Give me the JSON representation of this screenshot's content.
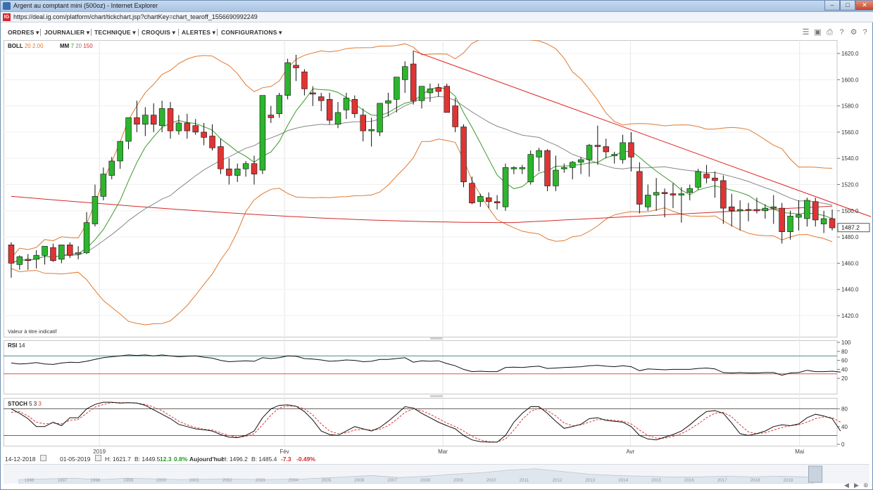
{
  "window": {
    "title": "Argent au comptant mini (500oz) - Internet Explorer",
    "url": "https://deal.ig.com/platform/chart/tickchart.jsp?chartKey=chart_tearoff_1556690992249",
    "logo": "IG"
  },
  "menu": [
    {
      "label": "ORDRES"
    },
    {
      "label": "JOURNALIER"
    },
    {
      "label": "TECHNIQUE"
    },
    {
      "label": "CROQUIS"
    },
    {
      "label": "ALERTES"
    },
    {
      "label": "CONFIGURATIONS"
    }
  ],
  "toolbar_icons": [
    "layers-icon",
    "image-icon",
    "print-icon",
    "help-icon",
    "settings-icon",
    "question-icon",
    "expand-icon"
  ],
  "panels": {
    "price": {
      "boll_name": "BOLL",
      "boll_params": "20 2.00",
      "mm_name": "MM",
      "mm_params": [
        "7",
        "20",
        "150"
      ],
      "note": "Valeur à titre indicatif",
      "current_price": "1487.2"
    },
    "rsi": {
      "label": "RSI",
      "params": "14"
    },
    "stoch": {
      "label": "STOCH",
      "params": [
        "5",
        "3",
        "3"
      ]
    }
  },
  "footer": {
    "start_date": "14-12-2018",
    "end_date": "01-05-2019",
    "high": "H: 1621.7",
    "low": "B: 1449.5",
    "change": "12.3",
    "change_pct": "0.8%",
    "today_label": "Aujourd'hui:",
    "today_high": "H: 1496.2",
    "today_low": "B: 1485.4",
    "today_change": "-7.3",
    "today_change_pct": "-0.49%"
  },
  "navigator_years": [
    "1996",
    "1997",
    "1998",
    "1999",
    "2000",
    "2001",
    "2002",
    "2003",
    "2004",
    "2005",
    "2006",
    "2007",
    "2008",
    "2009",
    "2010",
    "2011",
    "2012",
    "2013",
    "2014",
    "2015",
    "2016",
    "2017",
    "2018",
    "2019"
  ],
  "colors": {
    "up": "#2db52d",
    "down": "#e03434",
    "boll": "#e07a30",
    "mm7": "#3a9a2a",
    "mm20": "#888888",
    "mm150": "#d42a2a",
    "trendline": "#e02020"
  },
  "chart_data": [
    {
      "type": "candlestick",
      "x_labels": [
        "2019",
        "Fév",
        "Mar",
        "Avr",
        "Mai"
      ],
      "y_ticks": [
        1420.0,
        1440.0,
        1460.0,
        1480.0,
        1500.0,
        1520.0,
        1540.0,
        1560.0,
        1580.0,
        1600.0,
        1620.0
      ],
      "ylim": [
        1405,
        1627
      ],
      "candles": [
        [
          1474,
          1476,
          1449,
          1460
        ],
        [
          1459,
          1466,
          1455,
          1465
        ],
        [
          1463,
          1467,
          1455,
          1462
        ],
        [
          1463,
          1470,
          1456,
          1466
        ],
        [
          1466,
          1472,
          1459,
          1473
        ],
        [
          1472,
          1475,
          1461,
          1462
        ],
        [
          1463,
          1474,
          1460,
          1474
        ],
        [
          1474,
          1476,
          1464,
          1466
        ],
        [
          1467,
          1473,
          1463,
          1468
        ],
        [
          1468,
          1499,
          1467,
          1491
        ],
        [
          1490,
          1520,
          1488,
          1511
        ],
        [
          1511,
          1533,
          1508,
          1528
        ],
        [
          1527,
          1541,
          1524,
          1538
        ],
        [
          1538,
          1549,
          1532,
          1553
        ],
        [
          1553,
          1571,
          1547,
          1571
        ],
        [
          1571,
          1584,
          1560,
          1566
        ],
        [
          1566,
          1579,
          1557,
          1573
        ],
        [
          1573,
          1582,
          1560,
          1566
        ],
        [
          1565,
          1584,
          1560,
          1578
        ],
        [
          1578,
          1583,
          1555,
          1561
        ],
        [
          1561,
          1573,
          1558,
          1567
        ],
        [
          1567,
          1574,
          1555,
          1561
        ],
        [
          1565,
          1570,
          1558,
          1560
        ],
        [
          1560,
          1567,
          1550,
          1556
        ],
        [
          1557,
          1566,
          1546,
          1548
        ],
        [
          1549,
          1555,
          1528,
          1532
        ],
        [
          1532,
          1540,
          1520,
          1527
        ],
        [
          1527,
          1536,
          1522,
          1532
        ],
        [
          1532,
          1538,
          1526,
          1536
        ],
        [
          1536,
          1542,
          1520,
          1528
        ],
        [
          1531,
          1588,
          1528,
          1588
        ],
        [
          1573,
          1580,
          1567,
          1571
        ],
        [
          1574,
          1590,
          1571,
          1588
        ],
        [
          1588,
          1616,
          1585,
          1613
        ],
        [
          1611,
          1619,
          1599,
          1609
        ],
        [
          1606,
          1608,
          1588,
          1593
        ],
        [
          1590,
          1595,
          1580,
          1589
        ],
        [
          1587,
          1590,
          1576,
          1584
        ],
        [
          1585,
          1590,
          1566,
          1569
        ],
        [
          1566,
          1583,
          1563,
          1575
        ],
        [
          1577,
          1590,
          1570,
          1586
        ],
        [
          1585,
          1588,
          1571,
          1574
        ],
        [
          1573,
          1578,
          1553,
          1561
        ],
        [
          1561,
          1571,
          1549,
          1562
        ],
        [
          1560,
          1582,
          1557,
          1582
        ],
        [
          1582,
          1590,
          1572,
          1584
        ],
        [
          1585,
          1601,
          1575,
          1602
        ],
        [
          1600,
          1614,
          1590,
          1610
        ],
        [
          1612,
          1622,
          1581,
          1584
        ],
        [
          1584,
          1593,
          1578,
          1595
        ],
        [
          1590,
          1597,
          1583,
          1593
        ],
        [
          1594,
          1597,
          1587,
          1591
        ],
        [
          1595,
          1597,
          1583,
          1575
        ],
        [
          1580,
          1586,
          1560,
          1564
        ],
        [
          1564,
          1566,
          1518,
          1522
        ],
        [
          1521,
          1526,
          1505,
          1506
        ],
        [
          1507,
          1513,
          1503,
          1511
        ],
        [
          1510,
          1514,
          1502,
          1507
        ],
        [
          1507,
          1512,
          1501,
          1506
        ],
        [
          1503,
          1536,
          1500,
          1533
        ],
        [
          1532,
          1534,
          1528,
          1533
        ],
        [
          1532,
          1535,
          1528,
          1533
        ],
        [
          1522,
          1546,
          1520,
          1543
        ],
        [
          1541,
          1548,
          1530,
          1546
        ],
        [
          1546,
          1547,
          1515,
          1519
        ],
        [
          1519,
          1542,
          1515,
          1531
        ],
        [
          1532,
          1536,
          1529,
          1533
        ],
        [
          1533,
          1538,
          1524,
          1537
        ],
        [
          1537,
          1541,
          1528,
          1539
        ],
        [
          1539,
          1551,
          1526,
          1550
        ],
        [
          1550,
          1565,
          1535,
          1549
        ],
        [
          1549,
          1555,
          1540,
          1545
        ],
        [
          1542,
          1545,
          1536,
          1543
        ],
        [
          1539,
          1558,
          1536,
          1552
        ],
        [
          1552,
          1560,
          1530,
          1541
        ],
        [
          1530,
          1537,
          1498,
          1505
        ],
        [
          1503,
          1520,
          1500,
          1512
        ],
        [
          1512,
          1525,
          1500,
          1514
        ],
        [
          1514,
          1517,
          1495,
          1513
        ],
        [
          1513,
          1521,
          1502,
          1512
        ],
        [
          1512,
          1518,
          1491,
          1513
        ],
        [
          1514,
          1520,
          1508,
          1517
        ],
        [
          1518,
          1532,
          1516,
          1530
        ],
        [
          1528,
          1535,
          1521,
          1525
        ],
        [
          1525,
          1530,
          1510,
          1523
        ],
        [
          1523,
          1527,
          1490,
          1502
        ],
        [
          1503,
          1513,
          1488,
          1500
        ],
        [
          1500,
          1508,
          1485,
          1501
        ],
        [
          1501,
          1506,
          1492,
          1501
        ],
        [
          1501,
          1510,
          1498,
          1500
        ],
        [
          1500,
          1505,
          1494,
          1502
        ],
        [
          1502,
          1512,
          1490,
          1503
        ],
        [
          1502,
          1506,
          1475,
          1484
        ],
        [
          1484,
          1500,
          1478,
          1496
        ],
        [
          1495,
          1508,
          1485,
          1497
        ],
        [
          1494,
          1510,
          1488,
          1508
        ],
        [
          1507,
          1510,
          1488,
          1493
        ],
        [
          1490,
          1500,
          1483,
          1494
        ],
        [
          1494,
          1501,
          1485,
          1487
        ]
      ],
      "trendline": {
        "start": {
          "index": 48,
          "value": 1622
        },
        "end": {
          "index": 105,
          "value": 1490
        }
      },
      "current_price": 1487.2
    },
    {
      "type": "line",
      "name": "RSI 14",
      "y_ticks": [
        20,
        40,
        60,
        80,
        100
      ],
      "ylim": [
        0,
        100
      ],
      "bands": [
        30,
        70
      ],
      "values": [
        54,
        52,
        53,
        55,
        52,
        51,
        54,
        56,
        55,
        58,
        62,
        66,
        68,
        70,
        72,
        71,
        72,
        70,
        72,
        70,
        68,
        69,
        70,
        67,
        65,
        60,
        57,
        58,
        59,
        58,
        66,
        64,
        66,
        70,
        69,
        64,
        63,
        61,
        58,
        59,
        61,
        60,
        57,
        58,
        62,
        62,
        64,
        66,
        56,
        59,
        58,
        59,
        53,
        48,
        40,
        35,
        36,
        35,
        35,
        44,
        45,
        44,
        46,
        47,
        42,
        43,
        44,
        45,
        46,
        48,
        49,
        47,
        46,
        48,
        46,
        37,
        41,
        40,
        39,
        40,
        40,
        40,
        42,
        43,
        41,
        33,
        32,
        33,
        32,
        32,
        33,
        33,
        27,
        32,
        33,
        38,
        35,
        35,
        36,
        34
      ]
    },
    {
      "type": "line",
      "name": "STOCH 5 3 3",
      "y_ticks": [
        0,
        40,
        80
      ],
      "ylim": [
        0,
        100
      ],
      "bands": [
        20,
        80
      ],
      "series": [
        {
          "name": "%K",
          "values": [
            80,
            70,
            58,
            40,
            40,
            50,
            42,
            60,
            60,
            80,
            90,
            95,
            95,
            93,
            94,
            93,
            88,
            78,
            68,
            58,
            45,
            40,
            35,
            33,
            30,
            22,
            16,
            15,
            20,
            30,
            60,
            80,
            88,
            89,
            86,
            74,
            55,
            30,
            22,
            20,
            30,
            40,
            35,
            30,
            38,
            52,
            68,
            85,
            82,
            70,
            60,
            50,
            42,
            35,
            20,
            10,
            6,
            5,
            5,
            20,
            50,
            70,
            85,
            85,
            70,
            52,
            36,
            40,
            45,
            58,
            60,
            54,
            52,
            50,
            40,
            20,
            12,
            10,
            16,
            22,
            30,
            44,
            60,
            74,
            76,
            70,
            48,
            24,
            20,
            24,
            30,
            40,
            44,
            42,
            46,
            60,
            68,
            64,
            58,
            30
          ]
        },
        {
          "name": "%D",
          "values": [
            72,
            74,
            64,
            50,
            46,
            48,
            46,
            54,
            56,
            70,
            84,
            90,
            94,
            94,
            94,
            93,
            90,
            84,
            76,
            64,
            52,
            44,
            38,
            34,
            32,
            26,
            20,
            16,
            18,
            24,
            44,
            66,
            82,
            86,
            86,
            80,
            66,
            46,
            30,
            24,
            26,
            32,
            34,
            32,
            34,
            42,
            56,
            72,
            80,
            76,
            68,
            58,
            48,
            40,
            30,
            18,
            10,
            6,
            5,
            12,
            32,
            56,
            74,
            82,
            76,
            64,
            48,
            42,
            44,
            50,
            56,
            56,
            54,
            52,
            46,
            32,
            20,
            14,
            14,
            18,
            24,
            34,
            46,
            60,
            70,
            72,
            62,
            44,
            28,
            24,
            26,
            32,
            38,
            42,
            44,
            50,
            58,
            62,
            60,
            50
          ]
        }
      ]
    }
  ]
}
